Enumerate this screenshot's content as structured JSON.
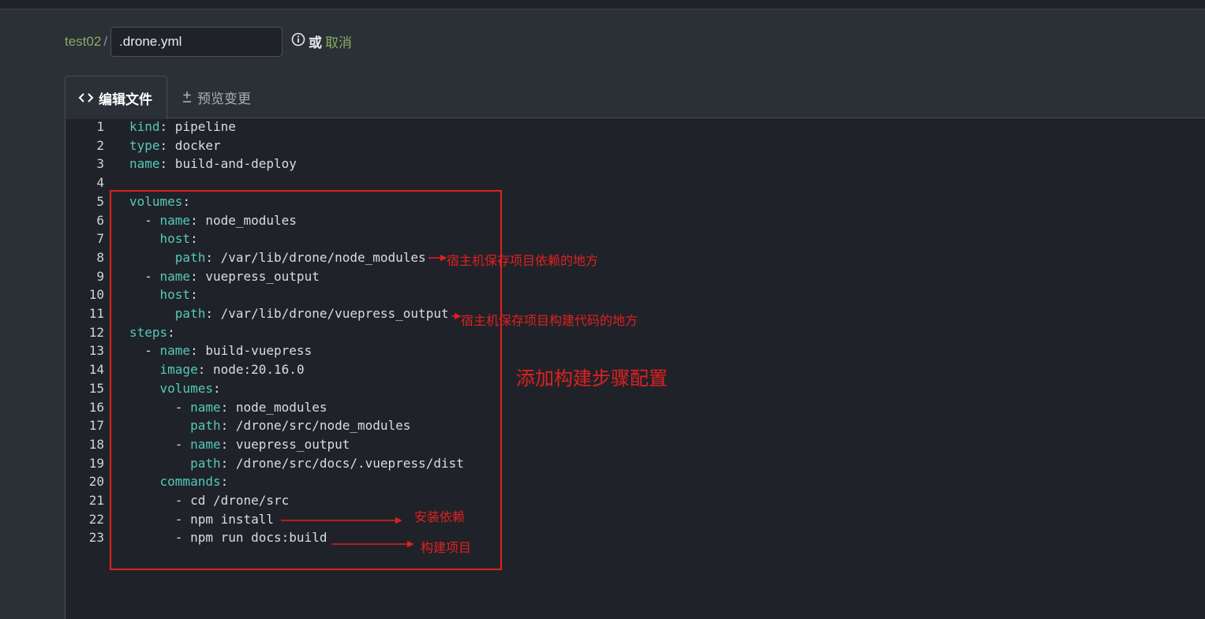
{
  "breadcrumb": {
    "repo": "test02",
    "separator": "/",
    "filename_value": ".drone.yml",
    "or_text": "或",
    "cancel_label": "取消"
  },
  "tabs": [
    {
      "label": "编辑文件",
      "icon": "code-icon",
      "active": true
    },
    {
      "label": "预览变更",
      "icon": "diff-icon",
      "active": false
    }
  ],
  "editor": {
    "lines": [
      {
        "n": "1",
        "indent": "",
        "key": "kind",
        "value": " pipeline"
      },
      {
        "n": "2",
        "indent": "",
        "key": "type",
        "value": " docker"
      },
      {
        "n": "3",
        "indent": "",
        "key": "name",
        "value": " build-and-deploy"
      },
      {
        "n": "4",
        "indent": "",
        "key": "",
        "value": ""
      },
      {
        "n": "5",
        "indent": "",
        "key": "volumes",
        "value": ""
      },
      {
        "n": "6",
        "indent": "  - ",
        "key": "name",
        "value": " node_modules"
      },
      {
        "n": "7",
        "indent": "    ",
        "key": "host",
        "value": ""
      },
      {
        "n": "8",
        "indent": "      ",
        "key": "path",
        "value": " /var/lib/drone/node_modules"
      },
      {
        "n": "9",
        "indent": "  - ",
        "key": "name",
        "value": " vuepress_output"
      },
      {
        "n": "10",
        "indent": "    ",
        "key": "host",
        "value": ""
      },
      {
        "n": "11",
        "indent": "      ",
        "key": "path",
        "value": " /var/lib/drone/vuepress_output"
      },
      {
        "n": "12",
        "indent": "",
        "key": "steps",
        "value": ""
      },
      {
        "n": "13",
        "indent": "  - ",
        "key": "name",
        "value": " build-vuepress"
      },
      {
        "n": "14",
        "indent": "    ",
        "key": "image",
        "value": " node:20.16.0"
      },
      {
        "n": "15",
        "indent": "    ",
        "key": "volumes",
        "value": ""
      },
      {
        "n": "16",
        "indent": "      - ",
        "key": "name",
        "value": " node_modules"
      },
      {
        "n": "17",
        "indent": "        ",
        "key": "path",
        "value": " /drone/src/node_modules"
      },
      {
        "n": "18",
        "indent": "      - ",
        "key": "name",
        "value": " vuepress_output"
      },
      {
        "n": "19",
        "indent": "        ",
        "key": "path",
        "value": " /drone/src/docs/.vuepress/dist"
      },
      {
        "n": "20",
        "indent": "    ",
        "key": "commands",
        "value": ""
      },
      {
        "n": "21",
        "indent": "      - ",
        "key": "",
        "value": "cd /drone/src"
      },
      {
        "n": "22",
        "indent": "      - ",
        "key": "",
        "value": "npm install"
      },
      {
        "n": "23",
        "indent": "      - ",
        "key": "",
        "value": "npm run docs:build"
      }
    ]
  },
  "annotations": {
    "host_modules": "宿主机保存项目依赖的地方",
    "host_output": "宿主机保存项目构建代码的地方",
    "add_steps": "添加构建步骤配置",
    "install_deps": "安装依赖",
    "build_project": "构建项目"
  },
  "colors": {
    "background": "#2b2f36",
    "editor_bg": "#1f2329",
    "yaml_key": "#56c8b8",
    "link_green": "#87ab63",
    "annotation_red": "#e0201f"
  }
}
